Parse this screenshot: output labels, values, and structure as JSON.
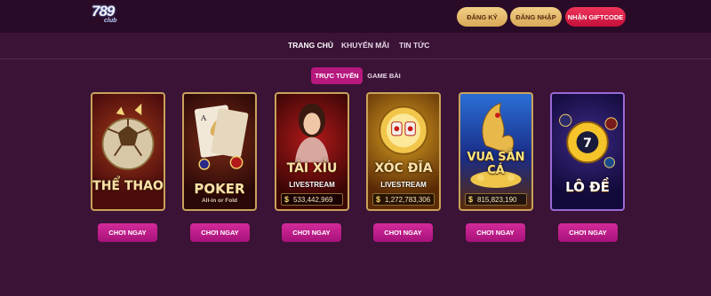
{
  "logo": {
    "number": "789",
    "sub": "club"
  },
  "header": {
    "register_label": "ĐĂNG KÝ",
    "login_label": "ĐĂNG NHẬP",
    "giftcode_label": "NHẬN GIFTCODE"
  },
  "nav": {
    "items": [
      "TRANG CHỦ",
      "KHUYẾN MÃI",
      "TIN TỨC"
    ]
  },
  "tabs": [
    "TRỰC TUYẾN",
    "GAME BÀI"
  ],
  "games": [
    {
      "title": "THỂ THAO",
      "icon": "football-icon"
    },
    {
      "title": "POKER",
      "sub": "All-in or Fold",
      "icon": "ace-card-icon"
    },
    {
      "title": "TÀI XỈU",
      "sub": "LIVESTREAM",
      "jackpot": "533,442,969",
      "icon": "dealer-icon"
    },
    {
      "title": "XÓC ĐĨA",
      "sub": "LIVESTREAM",
      "jackpot": "1,272,783,306",
      "icon": "dice-plate-icon"
    },
    {
      "title": "VUA SĂN CÁ",
      "jackpot": "815,823,190",
      "icon": "dragon-fish-icon"
    },
    {
      "title": "LÔ ĐỀ",
      "icon": "lottery-ball-icon"
    }
  ],
  "play_label": "CHƠI NGAY",
  "colors": {
    "background": "#3a1336",
    "topbar": "#2a0b27",
    "accent_pink": "#b7187e",
    "gold": "#d9a957",
    "gift_red": "#c4103b"
  }
}
